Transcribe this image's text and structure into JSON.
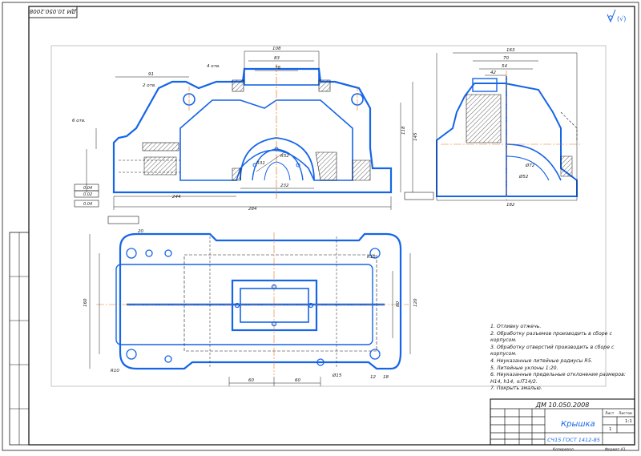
{
  "sheet": {
    "doc_code_top": "ДМ 10.050.2008",
    "surface_mark": "(√)",
    "drawing_code": "ДМ 10.050.2008",
    "part_name": "Крышка",
    "material": "СЧ15  ГОСТ 1412-85",
    "scale": "1:1",
    "sheets": "1",
    "sheet_label": "Лист",
    "sheets_label": "Листов",
    "copied_label": "Копировал",
    "format_label": "Формат А1"
  },
  "notes": [
    "1. Отливку отжечь.",
    "2. Обработку разъемов производить в сборе с корпусом.",
    "3. Обработку отверстий производить в сборе с корпусом.",
    "4. Неуказанные литейные радиусы R5.",
    "5. Литейные уклоны 1:20.",
    "6. Неуказанные предельные отклонения размеров: H14, h14, ±IT14/2.",
    "7. Покрыть эмалью."
  ],
  "tolerance_frames": [
    "0.04",
    "0.02",
    "0.04"
  ],
  "dims": {
    "d1": "108",
    "d2": "83",
    "d3": "78",
    "d4": "91",
    "d5": "2 отв.",
    "d6": "4 отв.",
    "d7": "6 отв.",
    "d8": "118",
    "d9": "145",
    "d10": "232",
    "d11": "244",
    "d12": "284",
    "d13": "120",
    "d14": "80",
    "d15": "R31",
    "d16": "R52",
    "d17": "163",
    "d18": "70",
    "d19": "54",
    "d20": "42",
    "d21": "Ø72",
    "d22": "Ø52",
    "d23": "182",
    "d24": "60",
    "d25": "60",
    "d26": "80",
    "d27": "160",
    "d28": "R10",
    "d29": "R15",
    "d30": "120",
    "d31": "Ø15",
    "d32": "12",
    "d33": "18",
    "d34": "20"
  },
  "colors": {
    "line_main": "#1565e8",
    "line_dark": "#1a1a1a",
    "hatch": "#1a1a1a",
    "axis": "#e07820",
    "frame": "#1a1a1a"
  }
}
